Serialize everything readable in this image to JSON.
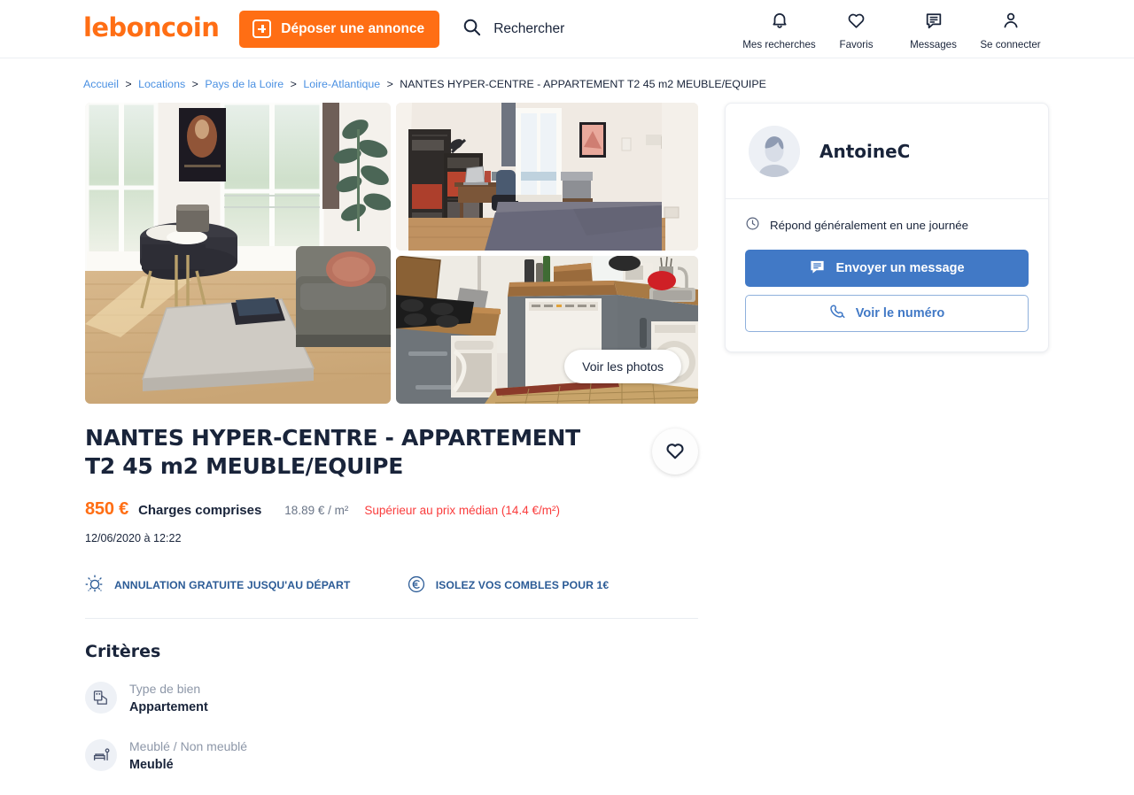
{
  "header": {
    "logo": "leboncoin",
    "deposit_label": "Déposer une annonce",
    "search_label": "Rechercher",
    "nav": [
      {
        "label": "Mes recherches",
        "icon": "bell-icon"
      },
      {
        "label": "Favoris",
        "icon": "heart-icon"
      },
      {
        "label": "Messages",
        "icon": "message-icon"
      },
      {
        "label": "Se connecter",
        "icon": "user-icon"
      }
    ]
  },
  "breadcrumb": {
    "items": [
      "Accueil",
      "Locations",
      "Pays de la Loire",
      "Loire-Atlantique"
    ],
    "separator": ">",
    "current": "NANTES HYPER-CENTRE - APPARTEMENT T2 45 m2 MEUBLE/EQUIPE"
  },
  "gallery": {
    "see_photos_label": "Voir les photos",
    "photos": [
      {
        "alt": "Salon avec table ronde, canapé et plante"
      },
      {
        "alt": "Chambre avec lit double, bureau et bibliothèque"
      },
      {
        "alt": "Cuisine équipée avec lave-vaisselle et plaque gaz"
      }
    ]
  },
  "ad": {
    "title": "NANTES HYPER-CENTRE - APPARTEMENT T2 45 m2 MEUBLE/EQUIPE",
    "price": "850 €",
    "charges": "Charges comprises",
    "price_per_m2": "18.89 € / m²",
    "median_note": "Supérieur au prix médian (14.4 €/m²)",
    "timestamp": "12/06/2020 à 12:22",
    "favorite_icon": "heart-icon"
  },
  "promos": [
    {
      "icon": "sun-icon",
      "label": "ANNULATION GRATUITE JUSQU'AU DÉPART"
    },
    {
      "icon": "euro-icon",
      "label": "ISOLEZ VOS COMBLES POUR 1€"
    }
  ],
  "criteria": {
    "heading": "Critères",
    "items": [
      {
        "icon": "property-type-icon",
        "key": "Type de bien",
        "value": "Appartement"
      },
      {
        "icon": "furnished-icon",
        "key": "Meublé / Non meublé",
        "value": "Meublé"
      }
    ]
  },
  "seller": {
    "name": "AntoineC",
    "avatar_icon": "avatar-icon",
    "reply_time": "Répond généralement en une journée",
    "clock_icon": "clock-icon",
    "message_button": "Envoyer un message",
    "phone_button": "Voir le numéro"
  },
  "colors": {
    "brand_orange": "#ff6e14",
    "link_blue": "#4a90e2",
    "primary_blue": "#4179c6",
    "promo_blue": "#2b5b96",
    "alert_red": "#fa3c3c",
    "text_dark": "#19243a",
    "muted": "#8d97a8"
  }
}
